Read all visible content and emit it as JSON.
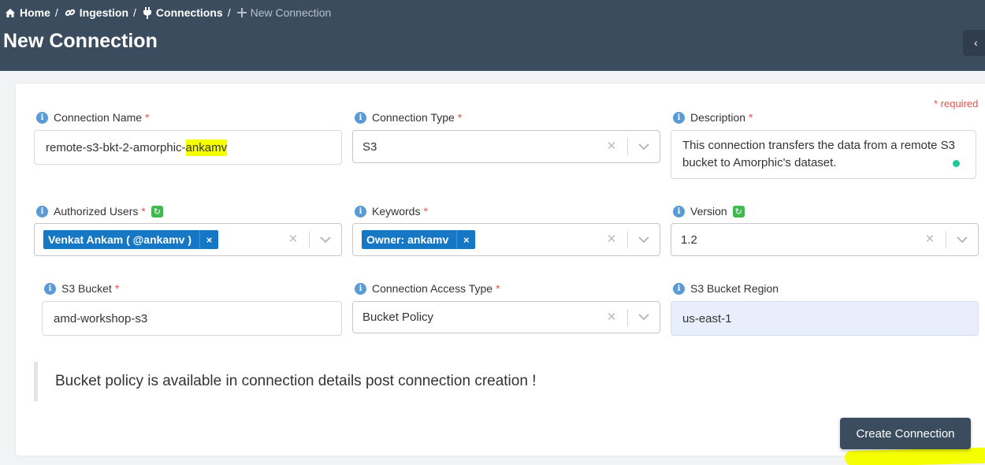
{
  "breadcrumb": {
    "home": "Home",
    "ingestion": "Ingestion",
    "connections": "Connections",
    "current": "New Connection",
    "separator": "/"
  },
  "page": {
    "title": "New Connection",
    "required_note": "* required"
  },
  "form": {
    "connection_name": {
      "label": "Connection Name",
      "value_prefix": "remote-s3-bkt-2-amorphic-",
      "value_highlight": "ankamv"
    },
    "connection_type": {
      "label": "Connection Type",
      "value": "S3"
    },
    "description": {
      "label": "Description",
      "value": "This connection transfers the data from a remote S3 bucket to Amorphic's dataset."
    },
    "authorized_users": {
      "label": "Authorized Users",
      "tag": "Venkat Ankam ( @ankamv )"
    },
    "keywords": {
      "label": "Keywords",
      "tag": "Owner: ankamv"
    },
    "version": {
      "label": "Version",
      "value": "1.2"
    },
    "s3_bucket": {
      "label": "S3 Bucket",
      "value": "amd-workshop-s3"
    },
    "connection_access_type": {
      "label": "Connection Access Type",
      "value": "Bucket Policy"
    },
    "s3_bucket_region": {
      "label": "S3 Bucket Region",
      "value": "us-east-1"
    }
  },
  "notice": "Bucket policy is available in connection details post connection creation !",
  "actions": {
    "create": "Create Connection"
  },
  "glyphs": {
    "required": "*",
    "clear": "×",
    "remove": "×",
    "info": "i",
    "refresh": "↻"
  },
  "colors": {
    "header_bg": "#3b4c5f",
    "tag_bg": "#1677c4",
    "required": "#e5534b",
    "highlight": "#f6ff00"
  }
}
